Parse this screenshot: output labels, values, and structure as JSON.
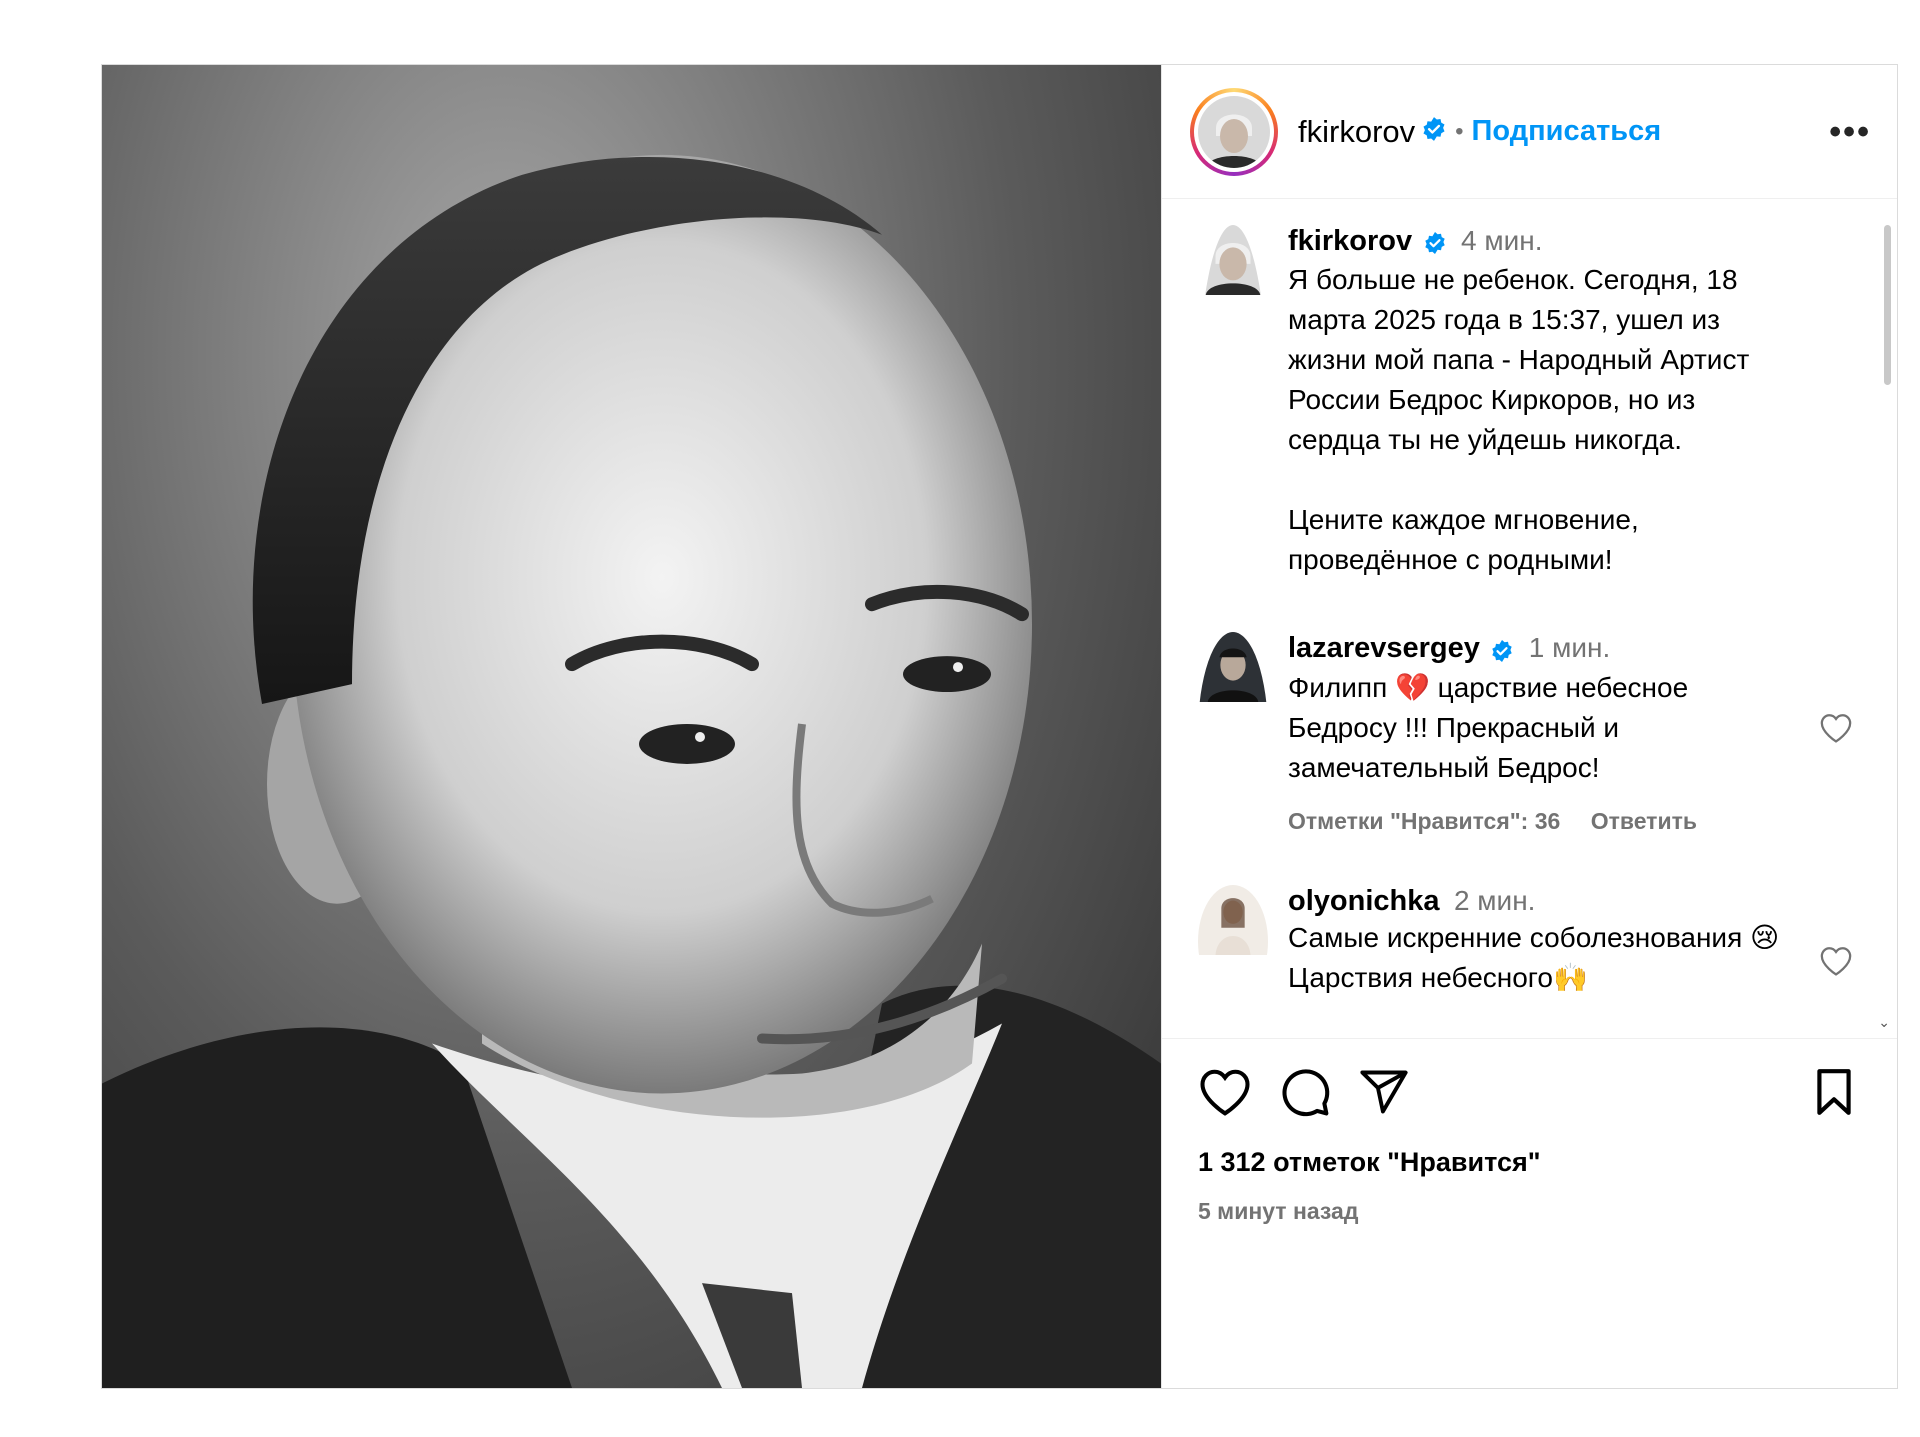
{
  "post": {
    "username": "fkirkorov",
    "follow_label": "Подписаться",
    "more_label": "•••",
    "photo_description": "black-and-white portrait of a man in a suit"
  },
  "caption": {
    "username": "fkirkorov",
    "time": "4 мин.",
    "paragraph1": "Я больше не ребенок. Сегодня, 18 марта 2025 года в 15:37, ушел из жизни мой папа - Народный Артист России Бедрос Киркоров, но из сердца ты не уйдешь никогда.",
    "paragraph2": "Цените каждое мгновение, проведённое с родными!"
  },
  "comments": [
    {
      "username": "lazarevsergey",
      "time": "1 мин.",
      "text": "Филипп 💔 царствие небесное Бедросу !!! Прекрасный и замечательный Бедрос!",
      "likes_label": "Отметки \"Нравится\": 36",
      "reply_label": "Ответить"
    },
    {
      "username": "olyonichka",
      "time": "2 мин.",
      "text": "Самые искренние соболезнования 😢 Царствия небесного🙌"
    }
  ],
  "footer": {
    "likes": "1 312 отметок \"Нравится\"",
    "time_ago": "5 минут назад"
  },
  "colors": {
    "accent": "#0095f6",
    "verified": "#0095f6",
    "muted": "#737373",
    "heart_broken": "#e0245e"
  },
  "icons": [
    "verified-badge-icon",
    "more-options-icon",
    "heart-icon",
    "comment-icon",
    "share-icon",
    "bookmark-icon"
  ]
}
